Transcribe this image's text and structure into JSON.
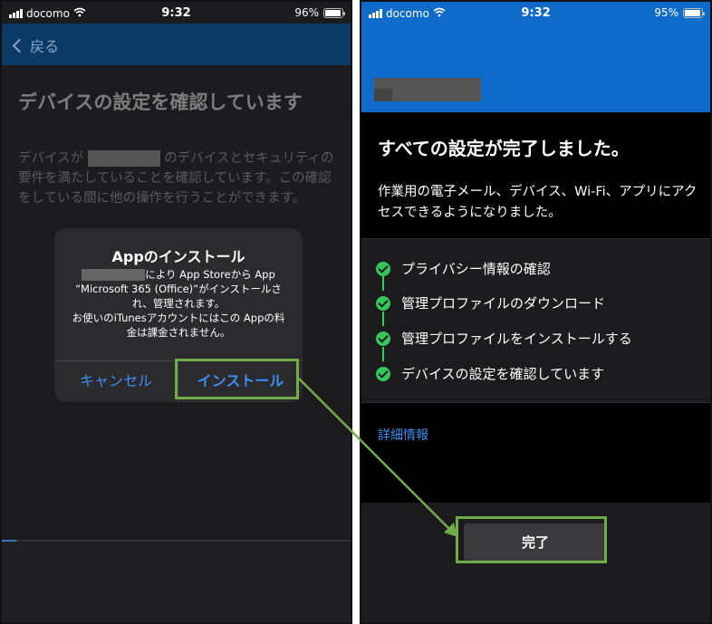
{
  "left_phone": {
    "status": {
      "carrier": "docomo",
      "time": "9:32",
      "battery": "96%",
      "battery_level": 0.96
    },
    "nav": {
      "back_label": "戻る"
    },
    "title": "デバイスの設定を確認しています",
    "description": {
      "before": "デバイスが",
      "after": "のデバイスとセキュリティの要件を満たしていることを確認しています。この確認をしている間に他の操作を行うことができます。"
    },
    "dialog": {
      "title": "Appのインストール",
      "body_line1": "により App Storeから App",
      "body_line2": "“Microsoft 365 (Office)”がインストールされ、管理されます。",
      "body_line3": "お使いのiTunesアカウントにはこの Appの料金は課金されません。",
      "cancel_label": "キャンセル",
      "install_label": "インストール"
    }
  },
  "right_phone": {
    "status": {
      "carrier": "docomo",
      "time": "9:32",
      "battery": "95%",
      "battery_level": 0.95
    },
    "title": "すべての設定が完了しました。",
    "description": "作業用の電子メール、デバイス、Wi-Fi、アプリにアクセスできるようになりました。",
    "steps": [
      {
        "label": "プライバシー情報の確認"
      },
      {
        "label": "管理プロファイルのダウンロード"
      },
      {
        "label": "管理プロファイルをインストールする"
      },
      {
        "label": "デバイスの設定を確認しています"
      }
    ],
    "details_link": "詳細情報",
    "done_label": "完了"
  },
  "colors": {
    "highlight": "#70ad47",
    "accent_blue": "#0f6bc9",
    "link": "#3d8ef5",
    "check": "#34c759"
  }
}
